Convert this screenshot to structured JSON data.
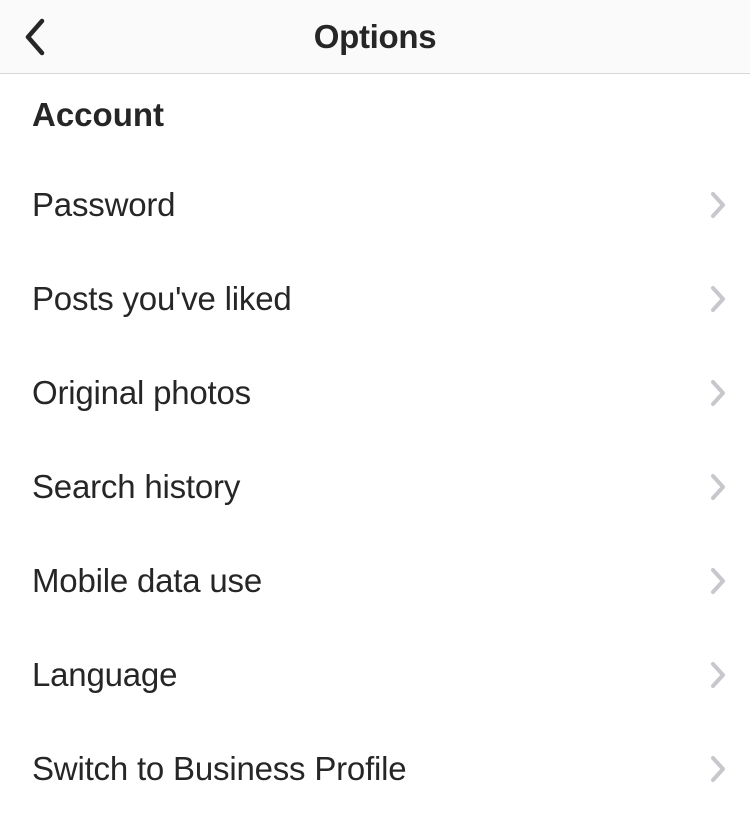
{
  "header": {
    "title": "Options"
  },
  "section": {
    "title": "Account"
  },
  "items": [
    {
      "label": "Password"
    },
    {
      "label": "Posts you've liked"
    },
    {
      "label": "Original photos"
    },
    {
      "label": "Search history"
    },
    {
      "label": "Mobile data use"
    },
    {
      "label": "Language"
    },
    {
      "label": "Switch to Business Profile"
    }
  ]
}
